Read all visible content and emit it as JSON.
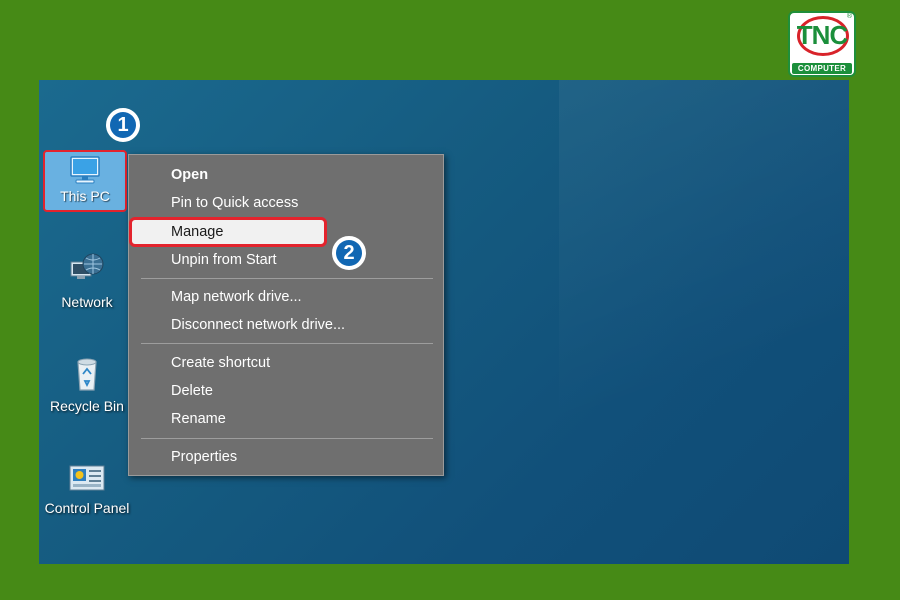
{
  "logo": {
    "text": "TNC",
    "subtext": "COMPUTER",
    "registered_mark": "®"
  },
  "steps": {
    "step1": "1",
    "step2": "2"
  },
  "desktop_icons": [
    {
      "label": "This PC",
      "icon": "computer-monitor-icon",
      "selected": true
    },
    {
      "label": "Network",
      "icon": "network-globe-icon"
    },
    {
      "label": "Recycle Bin",
      "icon": "recycle-bin-icon"
    },
    {
      "label": "Control Panel",
      "icon": "control-panel-icon"
    }
  ],
  "context_menu": {
    "items": [
      {
        "label": "Open",
        "bold": true
      },
      {
        "label": "Pin to Quick access"
      },
      {
        "label": "Manage",
        "highlighted": true
      },
      {
        "label": "Unpin from Start"
      },
      {
        "label": "Map network drive..."
      },
      {
        "label": "Disconnect network drive..."
      },
      {
        "label": "Create shortcut"
      },
      {
        "label": "Delete"
      },
      {
        "label": "Rename"
      },
      {
        "label": "Properties"
      }
    ]
  },
  "colors": {
    "frame_green": "#468a16",
    "highlight_red": "#e3232d",
    "badge_blue": "#1167b3",
    "menu_bg": "#6f6f6f"
  }
}
